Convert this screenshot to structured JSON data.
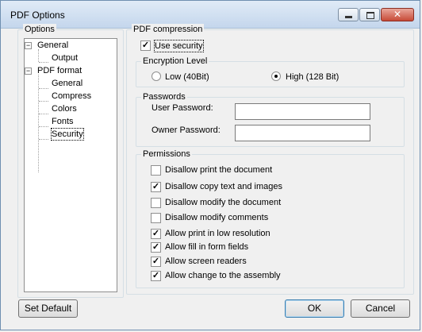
{
  "window": {
    "title": "PDF Options"
  },
  "options_group": {
    "label": "Options"
  },
  "tree": {
    "general": "General",
    "output": "Output",
    "pdf_format": "PDF format",
    "pf_general": "General",
    "compress": "Compress",
    "colors": "Colors",
    "fonts": "Fonts",
    "security": "Security"
  },
  "compression_group": {
    "label": "PDF compression"
  },
  "use_security": {
    "label": "Use security",
    "checked": true
  },
  "encryption": {
    "label": "Encryption Level",
    "low": "Low (40Bit)",
    "high": "High (128 Bit)",
    "selected": "high"
  },
  "passwords": {
    "label": "Passwords",
    "user_label": "User Password:",
    "user_value": "",
    "owner_label": "Owner Password:",
    "owner_value": ""
  },
  "permissions": {
    "label": "Permissions",
    "items": [
      {
        "label": "Disallow print the document",
        "checked": false
      },
      {
        "label": "Disallow copy text and images",
        "checked": true
      },
      {
        "label": "Disallow modify the document",
        "checked": false
      },
      {
        "label": "Disallow modify comments",
        "checked": false
      },
      {
        "label": "Allow print in low resolution",
        "checked": true
      },
      {
        "label": "Allow fill in form fields",
        "checked": true
      },
      {
        "label": "Allow screen readers",
        "checked": true
      },
      {
        "label": "Allow change to the assembly",
        "checked": true
      }
    ]
  },
  "buttons": {
    "set_default": "Set Default",
    "ok": "OK",
    "cancel": "Cancel"
  }
}
